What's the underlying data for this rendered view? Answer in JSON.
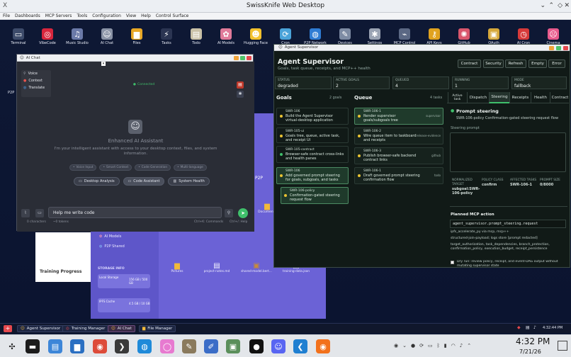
{
  "os_window": {
    "title": "SwissKnife Web Desktop",
    "menu": [
      "File",
      "Dashboards",
      "MCP Servers",
      "Tools",
      "Configuration",
      "View",
      "Help",
      "Control Surface"
    ]
  },
  "desktop_icons": [
    {
      "label": "Terminal",
      "icon": "terminal-icon",
      "glyph": "▭",
      "color": "#3d4b6a"
    },
    {
      "label": "VibeCode",
      "icon": "target-icon",
      "glyph": "◎",
      "color": "#d7263d"
    },
    {
      "label": "Music Studio",
      "icon": "music-icon",
      "glyph": "♫",
      "color": "#6b7aa8"
    },
    {
      "label": "AI Chat",
      "icon": "robot-icon",
      "glyph": "☺",
      "color": "#8a93a6"
    },
    {
      "label": "Files",
      "icon": "folder-icon",
      "glyph": "▆",
      "color": "#e9a825"
    },
    {
      "label": "Tasks",
      "icon": "lightning-icon",
      "glyph": "⚡",
      "color": "#2b3552"
    },
    {
      "label": "Todo",
      "icon": "clipboard-icon",
      "glyph": "▤",
      "color": "#c9c1a7"
    },
    {
      "label": "AI Models",
      "icon": "brain-icon",
      "glyph": "✿",
      "color": "#e07a9a"
    },
    {
      "label": "Hugging Face",
      "icon": "hugging-face-icon",
      "glyph": "☻",
      "color": "#f2c12e"
    },
    {
      "label": "Cron",
      "icon": "sync-icon",
      "glyph": "⟳",
      "color": "#4aa3d9"
    },
    {
      "label": "P2P Network",
      "icon": "globe-icon",
      "glyph": "◍",
      "color": "#2f7cd3"
    },
    {
      "label": "Devices",
      "icon": "wrench-icon",
      "glyph": "✎",
      "color": "#7d8ba3"
    },
    {
      "label": "Settings",
      "icon": "gear-icon",
      "glyph": "✱",
      "color": "#9aa3b3"
    },
    {
      "label": "MCP Control",
      "icon": "plug-icon",
      "glyph": "⌁",
      "color": "#5b6884"
    },
    {
      "label": "API Keys",
      "icon": "key-icon",
      "glyph": "⚷",
      "color": "#e0a21f"
    },
    {
      "label": "GitHub",
      "icon": "octopus-icon",
      "glyph": "✺",
      "color": "#d9566c"
    },
    {
      "label": "OAuth",
      "icon": "lock-icon",
      "glyph": "▣",
      "color": "#d6a83b"
    },
    {
      "label": "AI Cron",
      "icon": "clock-icon",
      "glyph": "◷",
      "color": "#d73a3a"
    },
    {
      "label": "Cinema",
      "icon": "face-icon",
      "glyph": "☹",
      "color": "#e85a8c"
    }
  ],
  "ai_chat": {
    "title": "AI Chat",
    "menu": [
      "Voice",
      "Context",
      "Translate"
    ],
    "status": "Connected",
    "welcome_title": "Enhanced AI Assistant",
    "welcome_text": "I'm your intelligent assistant with access to your desktop context, files, and system information.",
    "chips": [
      "Voice Input",
      "Smart Context",
      "Code Generation",
      "Multi-language"
    ],
    "actions": [
      "Desktop Analysis",
      "Code Assistant",
      "System Health"
    ],
    "input_value": "Help me write code",
    "char_count": "0 characters",
    "token_count": "~0 tokens",
    "shortcut_hint": "Ctrl+K: Commands",
    "help_hint": "Ctrl+/: Help"
  },
  "file_manager": {
    "sidebar": [
      "AI Models",
      "P2P Shared"
    ],
    "storage_title": "STORAGE INFO",
    "storage": [
      {
        "name": "Local Storage",
        "value": "156 GB / 500 GB"
      },
      {
        "name": "IPFS Cache",
        "value": "4.5 GB / 10 GB"
      }
    ],
    "files": [
      "Pictures",
      "project-notes.md",
      "shared-model.bert...",
      "training-data.json"
    ],
    "folder_documents": "Documents",
    "p2p_label": "P2P"
  },
  "training": {
    "title": "Training Progress"
  },
  "agent": {
    "window_title": "Agent Supervisor",
    "heading": "Agent Supervisor",
    "subheading": "Goals, task queue, receipts, and MCP++ health",
    "header_buttons": [
      "Contract",
      "Security",
      "Refresh",
      "Empty",
      "Error"
    ],
    "stats": [
      {
        "label": "STATUS",
        "value": "degraded"
      },
      {
        "label": "ACTIVE GOALS",
        "value": "2"
      },
      {
        "label": "QUEUED",
        "value": "4"
      },
      {
        "label": "RUNNING",
        "value": "1"
      },
      {
        "label": "MODE",
        "value": "fallback"
      }
    ],
    "goals_title": "Goals",
    "goals_count": "2 goals",
    "goals": [
      {
        "id": "SWR-106",
        "text": "Build the Agent Supervisor virtual-desktop application",
        "dot": "#e9c332"
      },
      {
        "id": "SWR-105-ui",
        "text": "Goals tree, queue, active task, and receipt UI",
        "dot": "#e9c332"
      },
      {
        "id": "SWR-105-contract",
        "text": "Browser-safe contract cross-links and health panes",
        "dot": "#3fbf6b"
      },
      {
        "id": "SWR-106",
        "text": "Add governed prompt steering for goals, subgoals, and tasks",
        "dot": "#e9c332"
      },
      {
        "id": "SWR-106-policy",
        "text": "Confirmation-gated steering request flow",
        "dot": "#e9c332"
      }
    ],
    "queue_title": "Queue",
    "queue_count": "4 tasks",
    "queue": [
      {
        "id": "SWR-106-1",
        "text": "Render supervisor goals/subgoals tree",
        "tag": "supervisor"
      },
      {
        "id": "SWR-106-2",
        "text": "Wire queue item to taskboard and receipts",
        "tag": "release-evidence"
      },
      {
        "id": "SWR-106-3",
        "text": "Publish browser-safe backend contract links",
        "tag": "github"
      },
      {
        "id": "SWR-106-1",
        "text": "Draft governed prompt steering confirmation flow",
        "tag": "todo"
      }
    ],
    "tabs": [
      "Active task",
      "Dispatch",
      "Steering",
      "Receipts",
      "Health",
      "Contract"
    ],
    "steering_title": "Prompt steering",
    "steering_sub": "SWR-106-policy Confirmation-gated steering request flow",
    "steering_prompt_label": "Steering prompt",
    "kv": [
      {
        "k": "NORMALIZED TARGET",
        "v": "subgoal:SWR-106-policy"
      },
      {
        "k": "POLICY CLASS",
        "v": "confirm"
      },
      {
        "k": "AFFECTED TASKS",
        "v": "SWR-106-1"
      },
      {
        "k": "PROMPT SIZE",
        "v": "0/8000"
      }
    ],
    "planned_title": "Planned MCP action",
    "planned_code": "agent_supervisor.prompt_steering.request",
    "planned_lines": [
      "ipfs_accelerate_py via mcp, mcp++",
      "structured-join-payload; logs store [prompt redacted]",
      "target_authorization, task_dependencies, branch_protection, confirmation_policy, execution_budget, receipt_persistence"
    ],
    "dry_run": "Dry run: review policy, receipt, and event-DAG output without mutating supervisor state"
  },
  "window_taskbar": [
    "Agent Supervisor",
    "Training Manager",
    "AI Chat",
    "File Manager"
  ],
  "os_taskbar": {
    "time": "4:32 PM",
    "clock_big": "4:32 PM",
    "date": "7/21/26",
    "small_time": "4:32:44 PM"
  }
}
